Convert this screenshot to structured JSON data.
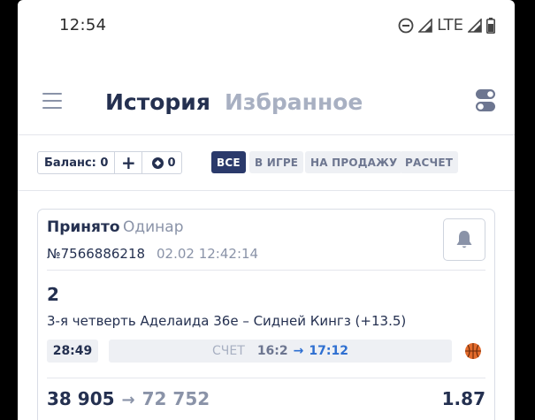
{
  "status_bar": {
    "time": "12:54",
    "network": "LTE",
    "icons": [
      "do-not-disturb-icon",
      "signal-icon",
      "signal-icon",
      "battery-icon"
    ]
  },
  "header": {
    "tabs": [
      {
        "label": "История",
        "active": true
      },
      {
        "label": "Избранное",
        "active": false
      }
    ],
    "menu_icon": "hamburger-icon",
    "settings_icon": "toggle-icon"
  },
  "balance": {
    "label": "Баланс: 0",
    "plus": "+",
    "coins": "0"
  },
  "filters": [
    {
      "label": "ВСЕ",
      "active": true
    },
    {
      "label": "В ИГРЕ",
      "active": false
    },
    {
      "label": "НА ПРОДАЖУ",
      "active": false
    },
    {
      "label": "РАСЧЕТ",
      "active": false
    }
  ],
  "bet": {
    "status": "Принято",
    "type": "Одинар",
    "number": "№7566886218",
    "datetime": "02.02 12:42:14",
    "count": "2",
    "event": "3-я четверть Аделаида 36е – Сидней Кингз (+13.5)",
    "timer": "28:49",
    "score_label": "СЧЕТ",
    "score_old": "16:2",
    "score_arrow": "→",
    "score_new": "17:12",
    "stake": "38 905",
    "amount_arrow": "→",
    "payout": "72 752",
    "odds": "1.87",
    "sport_icon": "basketball-icon"
  },
  "colors": {
    "primary": "#243050",
    "accent": "#2b3a6b",
    "muted": "#a8b0c2",
    "highlight": "#2e6fd1"
  }
}
